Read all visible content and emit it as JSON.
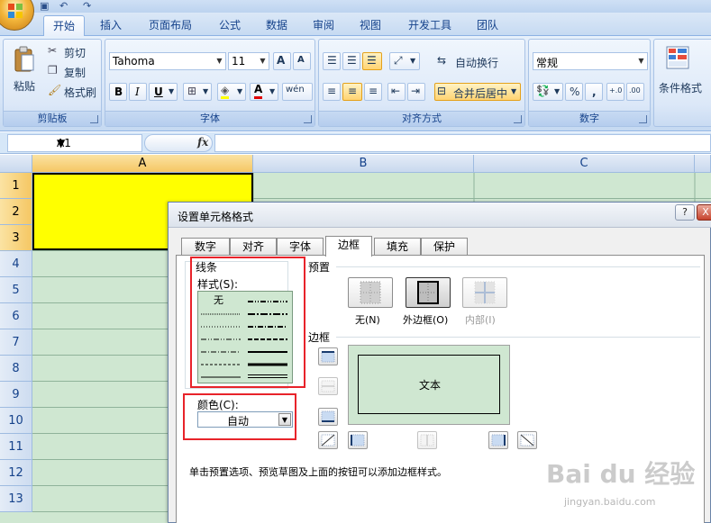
{
  "ribbon": {
    "tabs": [
      "开始",
      "插入",
      "页面布局",
      "公式",
      "数据",
      "审阅",
      "视图",
      "开发工具",
      "团队"
    ],
    "active_tab": "开始",
    "clipboard": {
      "paste": "粘贴",
      "cut": "剪切",
      "copy": "复制",
      "format_painter": "格式刷",
      "label": "剪贴板"
    },
    "font": {
      "family": "Tahoma",
      "size": "11",
      "bold": "B",
      "italic": "I",
      "underline": "U",
      "label": "字体"
    },
    "alignment": {
      "wrap_text": "自动换行",
      "merge_center": "合并后居中",
      "label": "对齐方式"
    },
    "number": {
      "format": "常规",
      "label": "数字"
    },
    "styles": {
      "conditional_format": "条件格式"
    }
  },
  "formula_bar": {
    "name_box": "A1",
    "fx": "fx"
  },
  "sheet": {
    "columns": [
      "A",
      "B",
      "C"
    ],
    "rows": [
      "1",
      "2",
      "3",
      "4",
      "5",
      "6",
      "7",
      "8",
      "9",
      "10",
      "11",
      "12",
      "13"
    ],
    "selected_cell_color": "#ffff00",
    "cell_color": "#cfe7d1"
  },
  "dialog": {
    "title": "设置单元格格式",
    "help": "?",
    "close": "X",
    "tabs": [
      "数字",
      "对齐",
      "字体",
      "边框",
      "填充",
      "保护"
    ],
    "active_tab": "边框",
    "line_section": "线条",
    "style_label": "样式(S):",
    "style_none": "无",
    "color_label": "颜色(C):",
    "color_value": "自动",
    "preset_section": "预置",
    "presets": [
      "无(N)",
      "外边框(O)",
      "内部(I)"
    ],
    "border_section": "边框",
    "preview_text": "文本",
    "hint": "单击预置选项、预览草图及上面的按钮可以添加边框样式。"
  },
  "watermark": {
    "logo": "Bai du 经验",
    "url": "jingyan.baidu.com"
  },
  "highlight_color": "#e8232a"
}
